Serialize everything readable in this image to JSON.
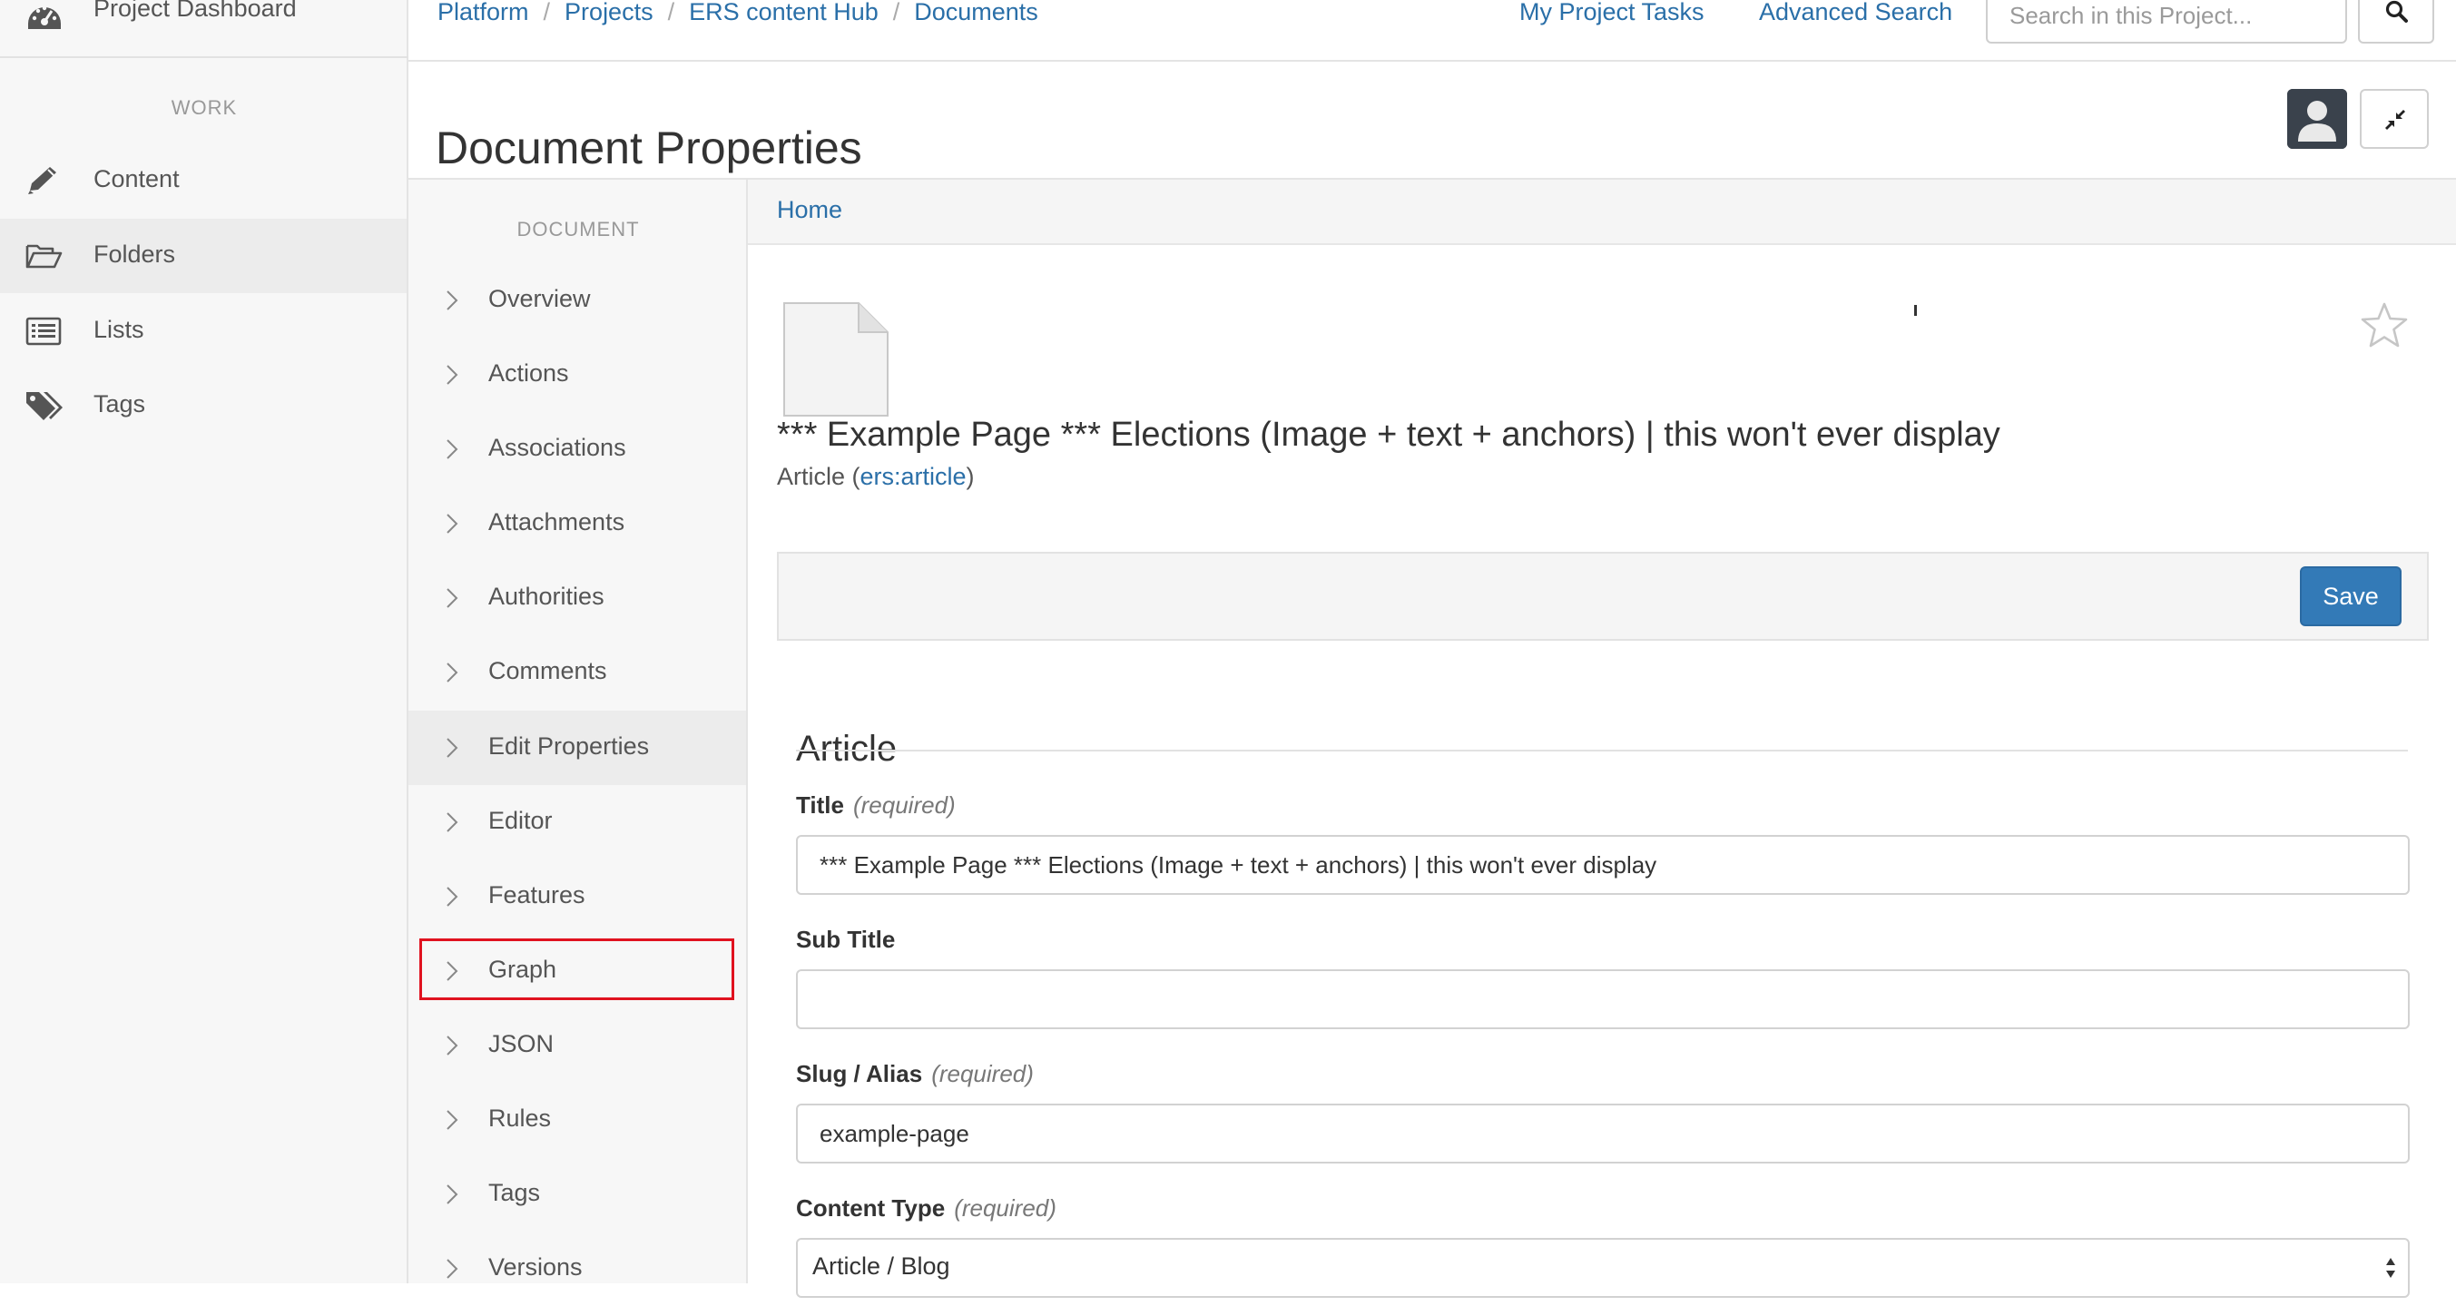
{
  "nav": {
    "top_item": {
      "label": "Project Dashboard",
      "icon": "dashboard-icon"
    },
    "section": "WORK",
    "items": [
      {
        "label": "Content",
        "icon": "pencil-icon"
      },
      {
        "label": "Folders",
        "icon": "folder-open-icon",
        "active": true
      },
      {
        "label": "Lists",
        "icon": "list-icon"
      },
      {
        "label": "Tags",
        "icon": "tags-icon"
      }
    ]
  },
  "topbar": {
    "breadcrumb": [
      "Platform",
      "Projects",
      "ERS content Hub",
      "Documents"
    ],
    "links": [
      "My Project Tasks",
      "Advanced Search"
    ],
    "search_placeholder": "Search in this Project...",
    "search_icon": "search-icon"
  },
  "header": {
    "title": "Document Properties",
    "avatar_icon": "user-avatar-icon",
    "collapse_icon": "compress-icon"
  },
  "doc_nav": {
    "section": "DOCUMENT",
    "items": [
      {
        "label": "Overview"
      },
      {
        "label": "Actions"
      },
      {
        "label": "Associations"
      },
      {
        "label": "Attachments"
      },
      {
        "label": "Authorities"
      },
      {
        "label": "Comments"
      },
      {
        "label": "Edit Properties",
        "active": true
      },
      {
        "label": "Editor"
      },
      {
        "label": "Features"
      },
      {
        "label": "Graph",
        "highlighted": true
      },
      {
        "label": "JSON"
      },
      {
        "label": "Rules"
      },
      {
        "label": "Tags"
      },
      {
        "label": "Versions"
      }
    ],
    "highlight_color": "#e0121f"
  },
  "content": {
    "breadcrumb": "Home",
    "doc_icon": "file-icon",
    "favorite_icon": "star-outline-icon",
    "document_title": "*** Example Page *** Elections (Image + text + anchors) | this won't ever display",
    "type_prefix": "Article (",
    "type_link": "ers:article",
    "type_suffix": ")",
    "save_label": "Save",
    "form": {
      "heading": "Article",
      "required_text": "(required)",
      "fields": {
        "title": {
          "label": "Title",
          "value": "*** Example Page *** Elections (Image + text + anchors) | this won't ever display"
        },
        "subtitle": {
          "label": "Sub Title",
          "value": ""
        },
        "slug": {
          "label": "Slug / Alias",
          "value": "example-page"
        },
        "content_type": {
          "label": "Content Type",
          "value": "Article / Blog"
        }
      }
    }
  },
  "colors": {
    "link": "#2a6fa8",
    "primary": "#337ab7",
    "highlight": "#e0121f"
  }
}
